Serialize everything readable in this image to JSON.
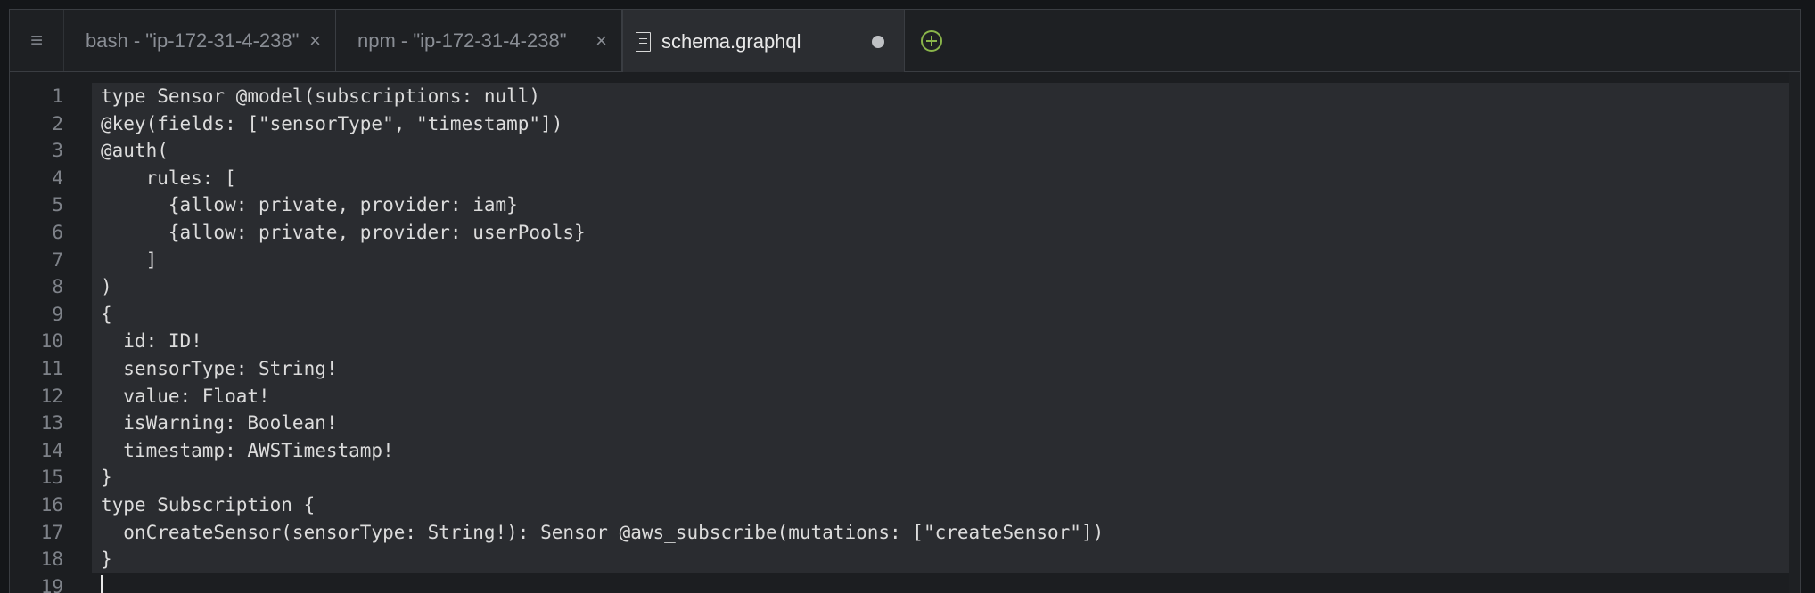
{
  "tabs": [
    {
      "label": "bash - \"ip-172-31-4-238\"",
      "close": "×"
    },
    {
      "label": "npm - \"ip-172-31-4-238\"",
      "close": "×"
    },
    {
      "label": "schema.graphql",
      "modified": true
    }
  ],
  "menu_glyph": "≡",
  "editor": {
    "lines": [
      {
        "n": "1",
        "text": "type Sensor @model(subscriptions: null)"
      },
      {
        "n": "2",
        "text": "@key(fields: [\"sensorType\", \"timestamp\"])"
      },
      {
        "n": "3",
        "text": "@auth("
      },
      {
        "n": "4",
        "text": "    rules: ["
      },
      {
        "n": "5",
        "text": "      {allow: private, provider: iam}"
      },
      {
        "n": "6",
        "text": "      {allow: private, provider: userPools}"
      },
      {
        "n": "7",
        "text": "    ]"
      },
      {
        "n": "8",
        "text": ")"
      },
      {
        "n": "9",
        "text": "{"
      },
      {
        "n": "10",
        "text": "  id: ID!"
      },
      {
        "n": "11",
        "text": "  sensorType: String!"
      },
      {
        "n": "12",
        "text": "  value: Float!"
      },
      {
        "n": "13",
        "text": "  isWarning: Boolean!"
      },
      {
        "n": "14",
        "text": "  timestamp: AWSTimestamp!"
      },
      {
        "n": "15",
        "text": "}"
      },
      {
        "n": "16",
        "text": "type Subscription {"
      },
      {
        "n": "17",
        "text": "  onCreateSensor(sensorType: String!): Sensor @aws_subscribe(mutations: [\"createSensor\"])"
      },
      {
        "n": "18",
        "text": "}"
      },
      {
        "n": "19",
        "text": ""
      }
    ]
  }
}
